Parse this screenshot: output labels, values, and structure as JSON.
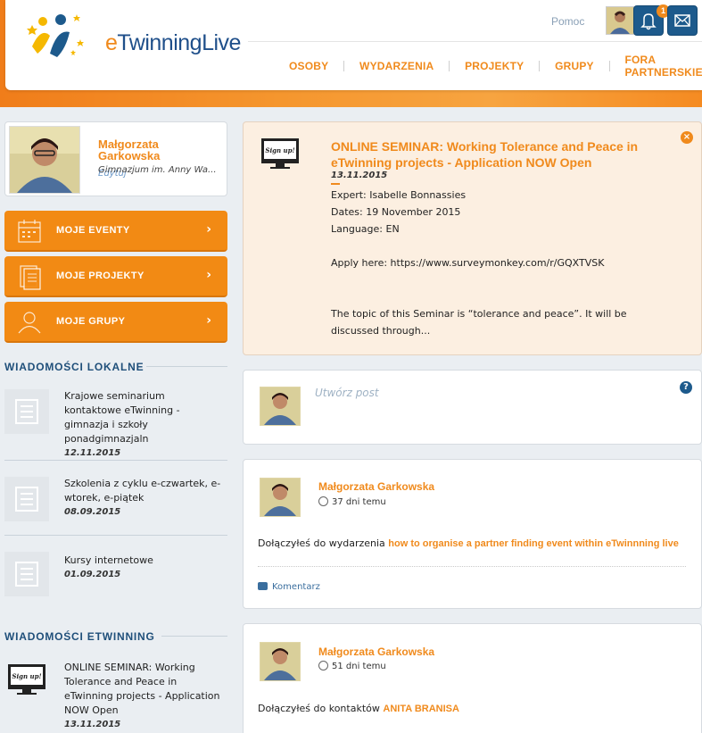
{
  "header": {
    "logo_text_e": "e",
    "logo_text_rest": "TwinningLive",
    "help_link": "Pomoc",
    "notification_count": "1"
  },
  "nav": {
    "items": [
      "OSOBY",
      "WYDARZENIA",
      "PROJEKTY",
      "GRUPY",
      "FORA PARTNERSKIE"
    ]
  },
  "profile": {
    "name": "Małgorzata Garkowska",
    "school": "Gimnazjum im. Anny Wa...",
    "edit": "Edytuj"
  },
  "sidebar_buttons": [
    {
      "label": "MOJE EVENTY",
      "icon": "calendar-icon"
    },
    {
      "label": "MOJE PROJEKTY",
      "icon": "documents-icon"
    },
    {
      "label": "MOJE GRUPY",
      "icon": "people-icon"
    }
  ],
  "local_news": {
    "title": "WIADOMOŚCI LOKALNE",
    "items": [
      {
        "text": "Krajowe seminarium kontaktowe eTwinning - gimnazja i szkoły ponadgimnazjaln",
        "date": "12.11.2015"
      },
      {
        "text": "Szkolenia z cyklu e-czwartek, e-wtorek, e-piątek",
        "date": "08.09.2015"
      },
      {
        "text": "Kursy internetowe",
        "date": "01.09.2015"
      }
    ]
  },
  "etwinning_news": {
    "title": "WIADOMOŚCI ETWINNING",
    "items": [
      {
        "text": "ONLINE SEMINAR: Working Tolerance and Peace in eTwinning projects - Application NOW Open",
        "date": "13.11.2015"
      }
    ]
  },
  "seminar": {
    "title": "ONLINE SEMINAR: Working Tolerance and Peace in eTwinning projects - Application NOW Open",
    "date": "13.11.2015",
    "expert": "Expert: Isabelle Bonnassies",
    "dates": "Dates: 19 November 2015",
    "language": "Language: EN",
    "apply": "Apply here:   https://www.surveymonkey.com/r/GQXTVSK",
    "topic": "The topic of this Seminar is “tolerance and peace”. It will be discussed through...",
    "thumb_text": "Sign up!"
  },
  "post_box": {
    "placeholder": "Utwórz post"
  },
  "feed": [
    {
      "author": "Małgorzata Garkowska",
      "time": "37 dni temu",
      "text": "Dołączyłeś do wydarzenia ",
      "link": "how to organise a partner finding event within eTwinnning live",
      "comment": "Komentarz"
    },
    {
      "author": "Małgorzata Garkowska",
      "time": "51 dni temu",
      "text": "Dołączyłeś do kontaktów ",
      "link": "ANITA BRANISA"
    }
  ],
  "colors": {
    "accent": "#f08a1c",
    "navy": "#1d5a8c",
    "background": "#eaeef2"
  }
}
